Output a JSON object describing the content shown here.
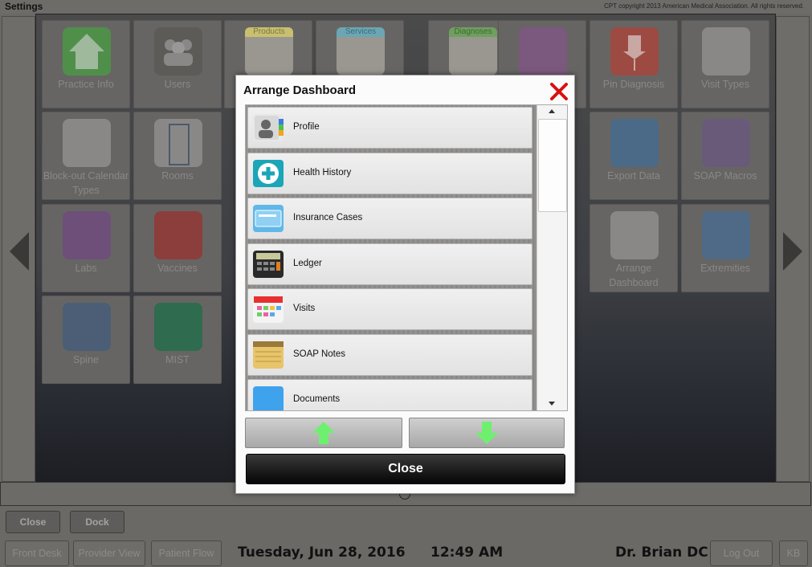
{
  "header": {
    "title": "Settings",
    "copyright": "CPT copyright 2013 American Medical Association. All rights reserved."
  },
  "tiles": [
    {
      "label": "Practice Info",
      "icon": "house-icon",
      "color": "#4f8f4a"
    },
    {
      "label": "Users",
      "icon": "users-icon",
      "color": "#5d5b58"
    },
    {
      "label": "",
      "icon": "products-notepad-icon",
      "color": "#c8c070",
      "note": "Products"
    },
    {
      "label": "",
      "icon": "services-notepad-icon",
      "color": "#6ba6b4",
      "note": "Services"
    },
    {
      "label": "",
      "icon": "diagnoses-notepad-icon",
      "color": "#6f9f5e",
      "note": "Diagnoses"
    },
    {
      "label": "",
      "icon": "pin-purple-icon",
      "color": "#7b587e"
    },
    {
      "label": "Pin Diagnosis",
      "icon": "pin-red-icon",
      "color": "#9c4a42"
    },
    {
      "label": "Visit Types",
      "icon": "visit-types-icon",
      "color": "#8a8886"
    },
    {
      "label": "Block-out Calendar Types",
      "icon": "calendar-types-icon",
      "color": "#8a8886"
    },
    {
      "label": "Rooms",
      "icon": "door-icon",
      "color": "#8a8886"
    },
    {
      "label": "Export Data",
      "icon": "export-icon",
      "color": "#4a6a88"
    },
    {
      "label": "SOAP Macros",
      "icon": "soap-macros-icon",
      "color": "#6a5a7a"
    },
    {
      "label": "Labs",
      "icon": "flask-icon",
      "color": "#6d4f7a"
    },
    {
      "label": "Vaccines",
      "icon": "syringe-icon",
      "color": "#8b3e3c"
    },
    {
      "label": "Arrange Dashboard",
      "icon": "arrange-dashboard-icon",
      "color": "#8a8886"
    },
    {
      "label": "Extremities",
      "icon": "body-icon",
      "color": "#4e6a86"
    },
    {
      "label": "Spine",
      "icon": "spine-icon",
      "color": "#4b5e76"
    },
    {
      "label": "MIST",
      "icon": "mist-icon",
      "color": "#2e6b4f"
    }
  ],
  "dialog": {
    "title": "Arrange Dashboard",
    "items": [
      {
        "label": "Profile",
        "icon": "profile-icon"
      },
      {
        "label": "Health History",
        "icon": "health-history-icon"
      },
      {
        "label": "Insurance Cases",
        "icon": "insurance-card-icon"
      },
      {
        "label": "Ledger",
        "icon": "calculator-icon"
      },
      {
        "label": "Visits",
        "icon": "visits-calendar-icon"
      },
      {
        "label": "SOAP Notes",
        "icon": "notepad-icon"
      },
      {
        "label": "Documents",
        "icon": "folder-icon"
      }
    ],
    "close_label": "Close"
  },
  "toolbar": {
    "close_label": "Close",
    "dock_label": "Dock"
  },
  "footer": {
    "front_desk": "Front Desk",
    "provider_view": "Provider View",
    "patient_flow": "Patient Flow",
    "date": "Tuesday, Jun 28, 2016",
    "time": "12:49 AM",
    "user": "Dr. Brian DC",
    "logout": "Log Out",
    "kb": "KB"
  }
}
